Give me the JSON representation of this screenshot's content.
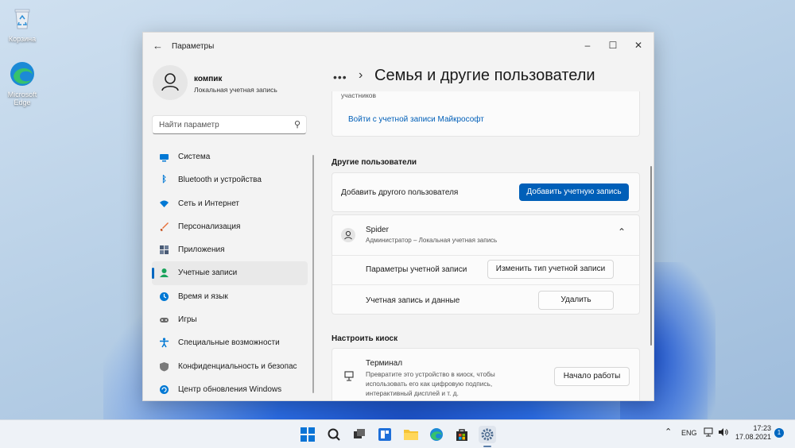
{
  "desktop": {
    "icons": [
      {
        "label": "Корзина",
        "icon": "recycle-bin-icon"
      },
      {
        "label": "Microsoft Edge",
        "icon": "edge-icon"
      }
    ]
  },
  "window": {
    "title": "Параметры",
    "controls": [
      "minimize",
      "maximize",
      "close"
    ]
  },
  "user": {
    "name": "компик",
    "account_type": "Локальная учетная запись"
  },
  "search": {
    "placeholder": "Найти параметр"
  },
  "nav": {
    "items": [
      {
        "label": "Система",
        "icon": "system-icon",
        "color": "#0078d4"
      },
      {
        "label": "Bluetooth и устройства",
        "icon": "bluetooth-icon",
        "color": "#0078d4"
      },
      {
        "label": "Сеть и Интернет",
        "icon": "wifi-icon",
        "color": "#0078d4"
      },
      {
        "label": "Персонализация",
        "icon": "brush-icon",
        "color": "#e8703a"
      },
      {
        "label": "Приложения",
        "icon": "apps-icon",
        "color": "#4a5b75"
      },
      {
        "label": "Учетные записи",
        "icon": "accounts-icon",
        "color": "#19a35b",
        "active": true
      },
      {
        "label": "Время и язык",
        "icon": "globe-clock-icon",
        "color": "#0078d4"
      },
      {
        "label": "Игры",
        "icon": "gamepad-icon",
        "color": "#6b6b6b"
      },
      {
        "label": "Специальные возможности",
        "icon": "accessibility-icon",
        "color": "#0078d4"
      },
      {
        "label": "Конфиденциальность и безопасность",
        "icon": "shield-icon",
        "color": "#6b6b6b"
      },
      {
        "label": "Центр обновления Windows",
        "icon": "update-icon",
        "color": "#0078d4"
      }
    ]
  },
  "main": {
    "breadcrumb_more": "•••",
    "page_title": "Семья и другие пользователи",
    "family_card": {
      "partial_text": "участников",
      "link": "Войти с учетной записи Майкрософт"
    },
    "other_users": {
      "header": "Другие пользователи",
      "add_label": "Добавить другого пользователя",
      "add_button": "Добавить учетную запись",
      "user": {
        "name": "Spider",
        "details": "Администратор – Локальная учетная запись"
      },
      "options_label": "Параметры учетной записи",
      "change_type_button": "Изменить тип учетной записи",
      "data_label": "Учетная запись и данные",
      "remove_button": "Удалить"
    },
    "kiosk": {
      "header": "Настроить киоск",
      "title": "Терминал",
      "description_lines": [
        "Превратите это устройство в киоск, чтобы",
        "использовать его как цифровую подпись,",
        "интерактивный дисплей и т. д."
      ],
      "start_button": "Начало работы"
    }
  },
  "taskbar": {
    "apps": [
      "start-icon",
      "search-icon",
      "task-view-icon",
      "widgets-icon",
      "file-explorer-icon",
      "edge-icon",
      "store-icon",
      "settings-icon"
    ],
    "language": "ENG",
    "time": "17:23",
    "date": "17.08.2021",
    "notification_count": "1"
  },
  "colors": {
    "accent": "#005fb8",
    "window_bg": "#f3f3f3",
    "card_bg": "#fbfbfb"
  }
}
